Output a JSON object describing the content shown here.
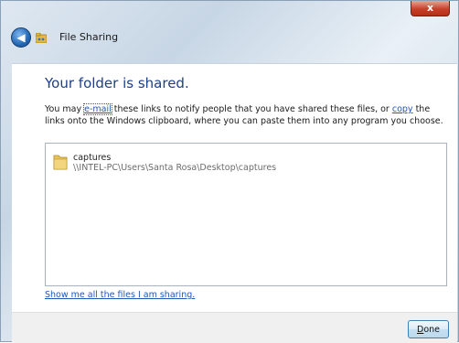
{
  "window": {
    "title": "File Sharing",
    "close_label": "x",
    "back_label": "◀"
  },
  "content": {
    "heading": "Your folder is shared.",
    "desc": {
      "part1": "You may ",
      "email_link": "e-mail",
      "part2": " these links to notify people that you have shared these files, or ",
      "copy_link": "copy",
      "part3": " the links onto the Windows clipboard, where you can paste them into any program you choose."
    },
    "shared_items": [
      {
        "name": "captures",
        "path": "\\\\INTEL-PC\\Users\\Santa Rosa\\Desktop\\captures"
      }
    ],
    "show_all_link": "Show me all the files I am sharing."
  },
  "footer": {
    "done_mnemonic": "D",
    "done_rest": "one"
  },
  "icons": {
    "back": "back-arrow-icon",
    "title": "sharing-icon",
    "folder": "folder-icon"
  },
  "colors": {
    "heading": "#1e3f88",
    "link": "#1f57b6",
    "close": "#c7402a"
  }
}
